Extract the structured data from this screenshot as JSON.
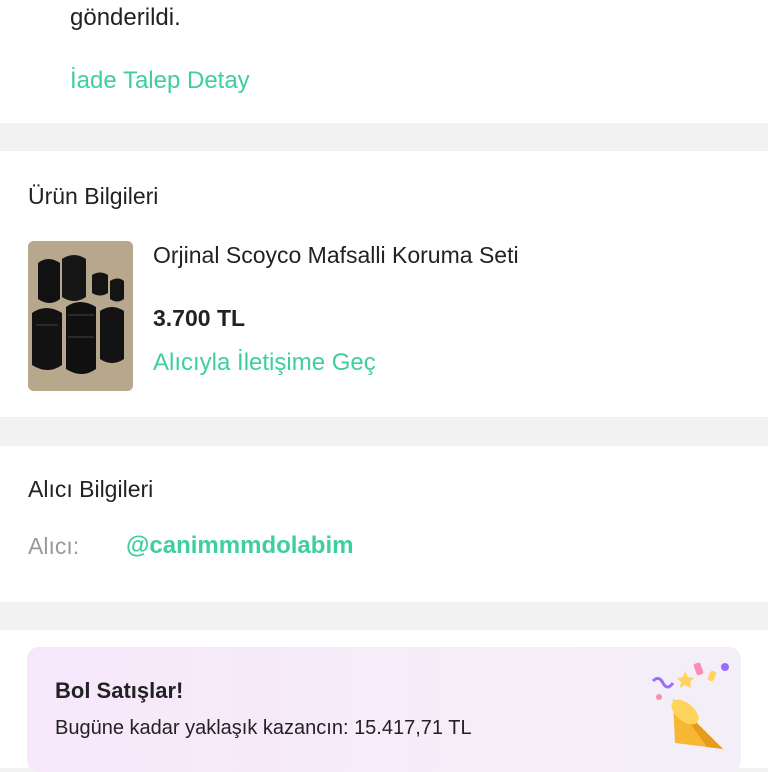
{
  "top": {
    "message_line": "gönderildi.",
    "return_link": "İade Talep Detay"
  },
  "product": {
    "section_title": "Ürün Bilgileri",
    "name": "Orjinal Scoyco Mafsalli Koruma Seti",
    "price": "3.700 TL",
    "contact_link": "Alıcıyla İletişime Geç",
    "thumbnail_icon": "product-photo-icon"
  },
  "buyer": {
    "section_title": "Alıcı Bilgileri",
    "label": "Alıcı:",
    "handle": "@canimmmdolabim"
  },
  "promo": {
    "title": "Bol Satışlar!",
    "text": "Bugüne kadar yaklaşık kazancın: 15.417,71 TL",
    "icon": "party-popper-icon"
  },
  "colors": {
    "accent": "#3ecf9b",
    "promo_bg": "#f6e9fa",
    "muted": "#9a9a9a"
  }
}
